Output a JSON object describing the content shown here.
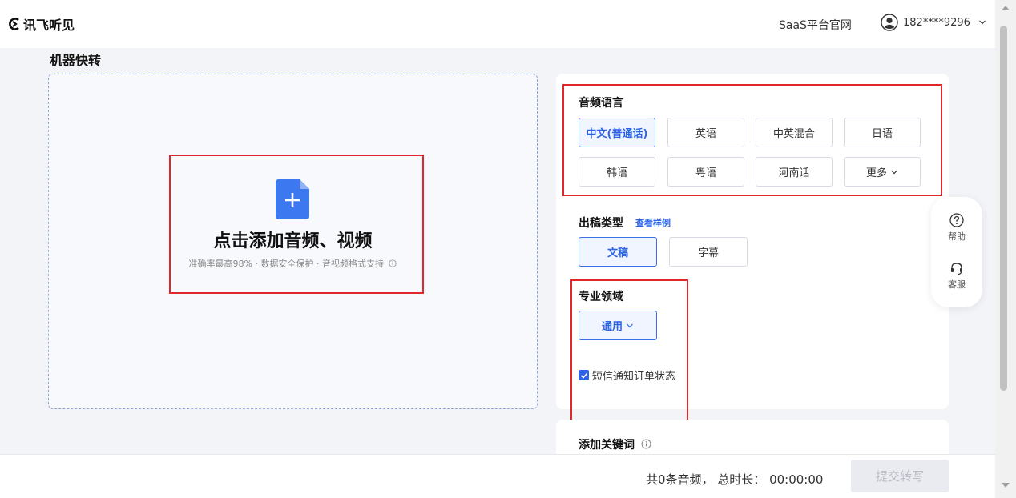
{
  "header": {
    "logo_text": "讯飞听见",
    "saas_link": "SaaS平台官网",
    "user_phone": "182****9296"
  },
  "page_title": "机器快转",
  "upload": {
    "title": "点击添加音频、视频",
    "subtitle": "准确率最高98% · 数据安全保护 · 音视频格式支持"
  },
  "audio_language": {
    "label": "音频语言",
    "options": [
      "中文(普通话)",
      "英语",
      "中英混合",
      "日语",
      "韩语",
      "粤语",
      "河南话",
      "更多"
    ],
    "selected": "中文(普通话)"
  },
  "output_type": {
    "label": "出稿类型",
    "sample_link": "查看样例",
    "options": [
      "文稿",
      "字幕"
    ],
    "selected": "文稿"
  },
  "domain": {
    "label": "专业领域",
    "selected": "通用"
  },
  "sms_notify": {
    "label": "短信通知订单状态",
    "checked": true
  },
  "keywords": {
    "label": "添加关键词"
  },
  "float_panel": {
    "help": "帮助",
    "service": "客服"
  },
  "footer": {
    "summary": "共0条音频， 总时长： 00:00:00",
    "submit": "提交转写"
  },
  "colors": {
    "accent": "#2d64e6",
    "highlight_box": "#e0282a"
  }
}
